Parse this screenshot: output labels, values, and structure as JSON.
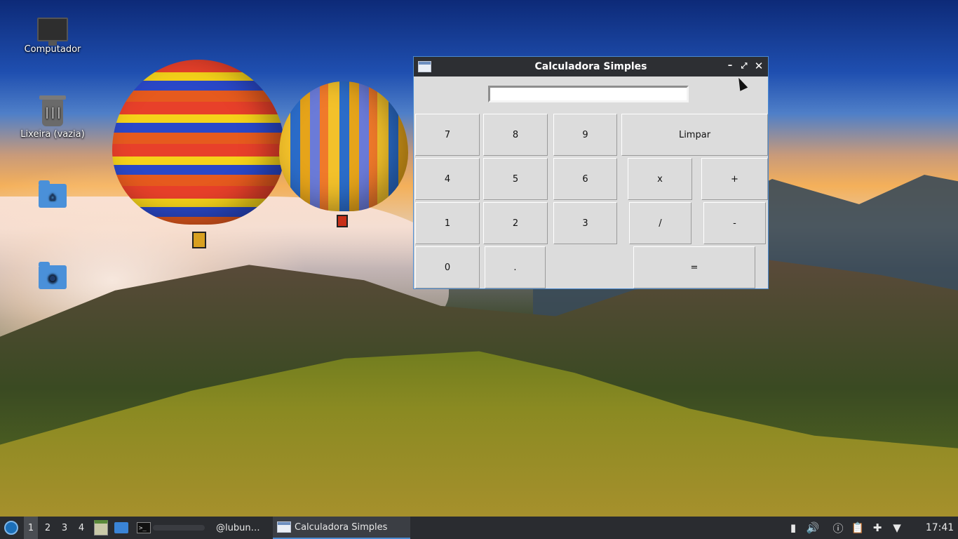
{
  "desktop": {
    "icons": [
      {
        "label": "Computador",
        "icon": "computer-icon"
      },
      {
        "label": "Lixeira (vazia)",
        "icon": "trash-icon"
      },
      {
        "label": "",
        "icon": "home-folder-icon"
      },
      {
        "label": "",
        "icon": "network-folder-icon"
      }
    ]
  },
  "window": {
    "title": "Calculadora Simples",
    "controls": {
      "minimize": "–",
      "maximize": "⤢",
      "close": "✕"
    },
    "display_value": "",
    "buttons": {
      "seven": "7",
      "eight": "8",
      "nine": "9",
      "clear": "Limpar",
      "four": "4",
      "five": "5",
      "six": "6",
      "multiply": "x",
      "add": "+",
      "one": "1",
      "two": "2",
      "three": "3",
      "divide": "/",
      "subtract": "-",
      "zero": "0",
      "decimal": ".",
      "equals": "="
    }
  },
  "taskbar": {
    "workspaces": [
      "1",
      "2",
      "3",
      "4"
    ],
    "active_workspace": "1",
    "tasks": [
      {
        "label": "@lubun…"
      },
      {
        "label": "Calculadora Simples"
      }
    ],
    "tray_icons": [
      "battery-icon",
      "volume-icon",
      "notification-icon",
      "clipboard-icon",
      "updates-icon",
      "wifi-icon"
    ],
    "tray_glyphs": {
      "battery": "▮",
      "volume": "🔊",
      "notification": "ⓘ",
      "clipboard": "📋",
      "updates": "✚",
      "wifi": "▼"
    },
    "clock": "17:41"
  },
  "colors": {
    "taskbar_bg": "#2a2c30",
    "titlebar_bg": "#2d2f33",
    "window_bg": "#dcdcdc",
    "accent": "#4a8ad0"
  }
}
